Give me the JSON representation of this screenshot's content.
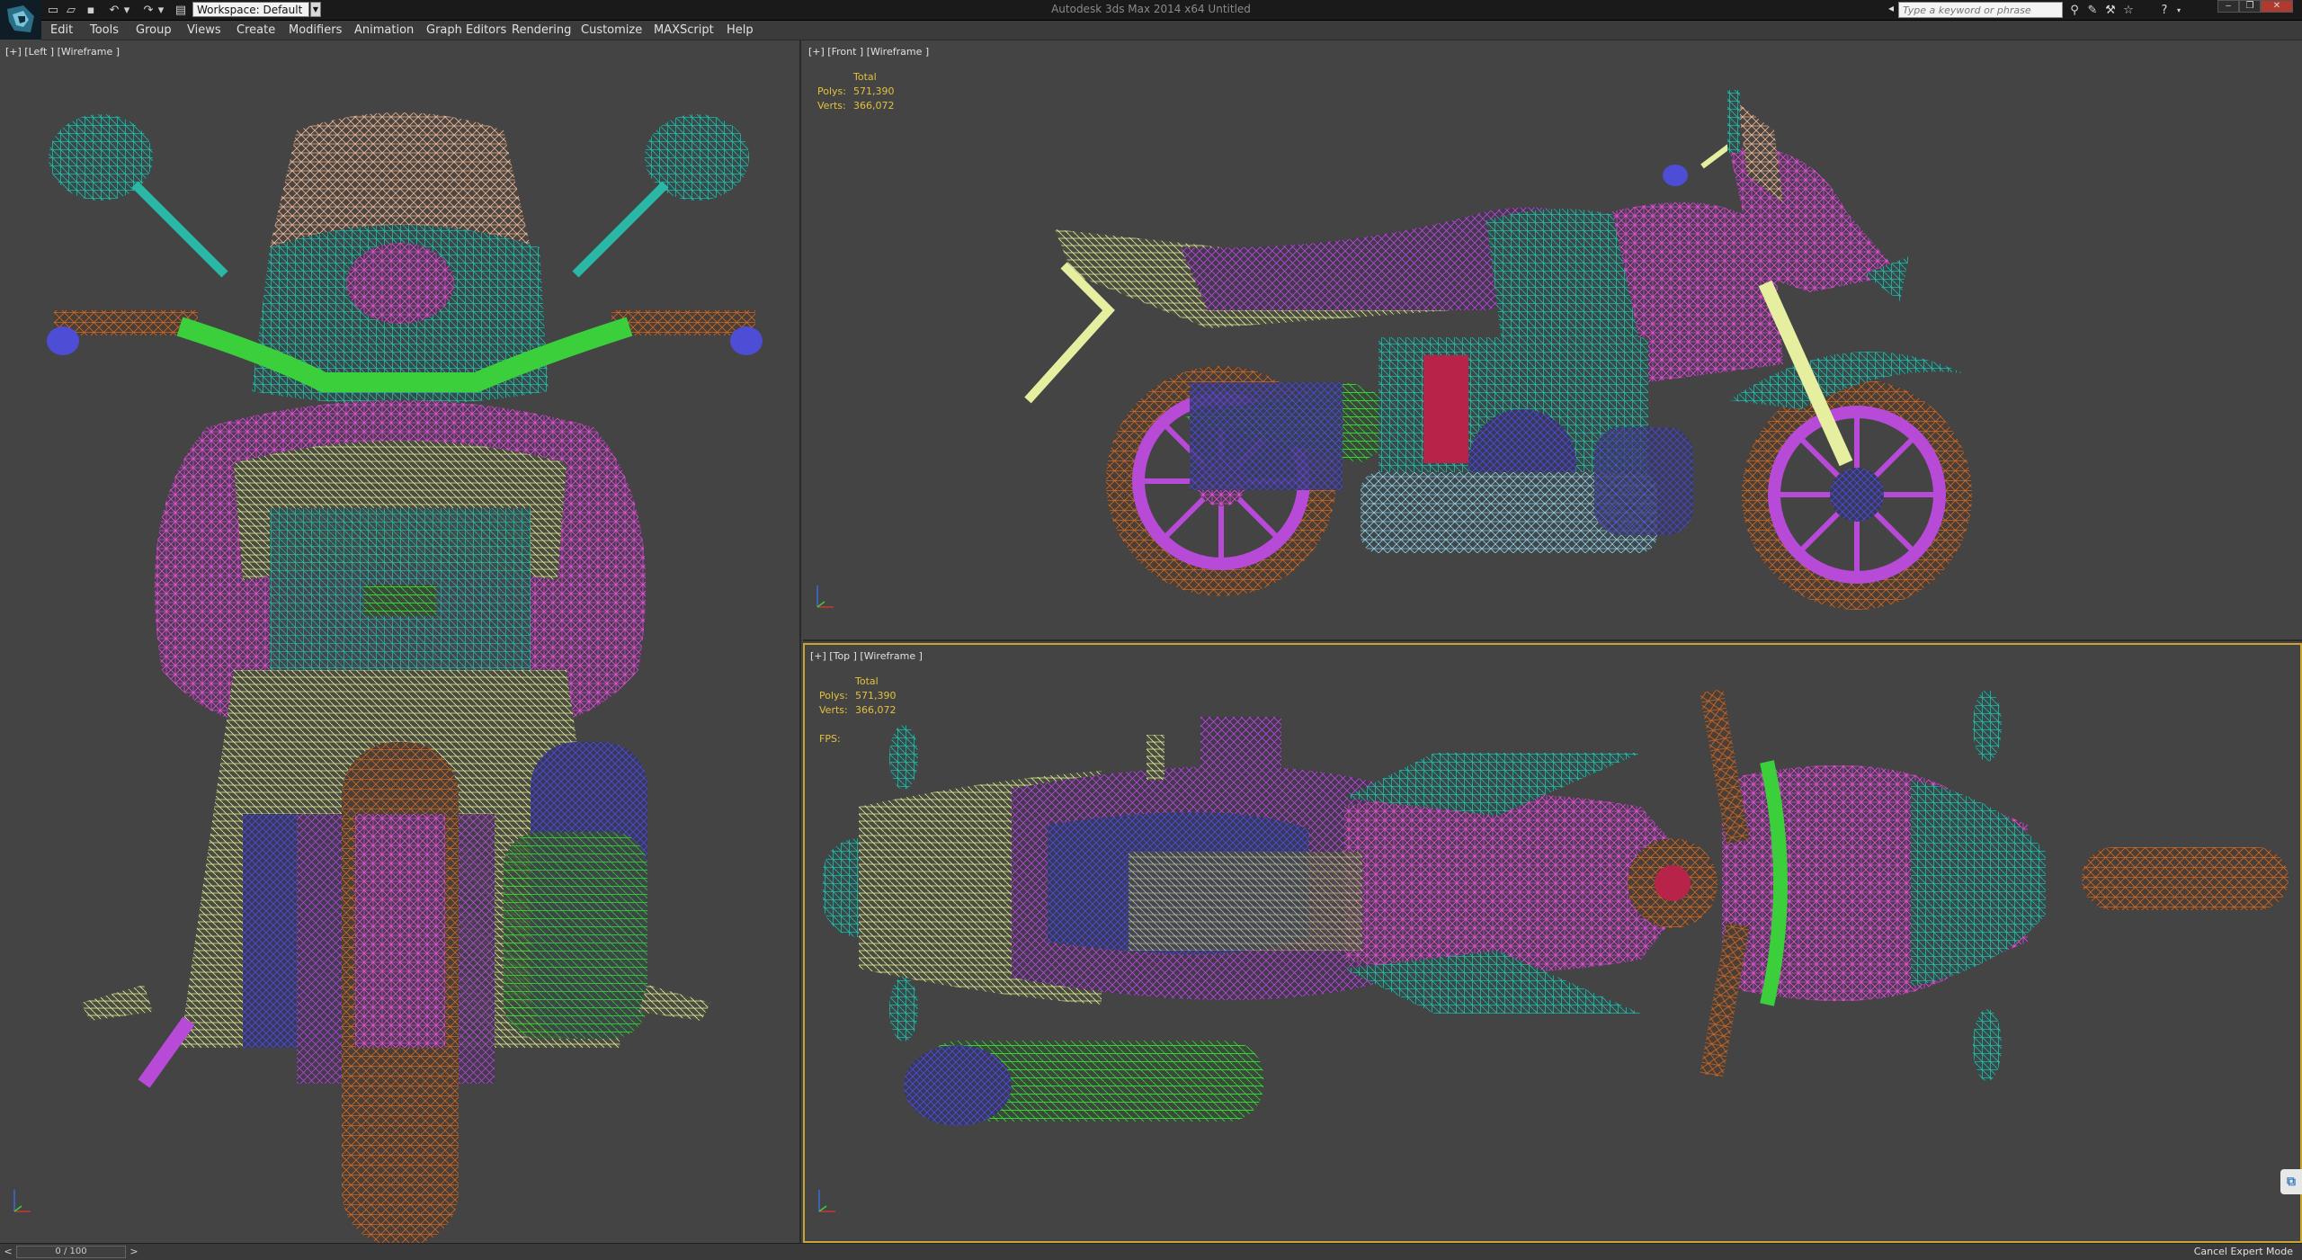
{
  "titlebar": {
    "workspace_label": "Workspace: Default",
    "window_title": "Autodesk 3ds Max  2014 x64     Untitled",
    "search_placeholder": "Type a keyword or phrase"
  },
  "menu": {
    "items": [
      "Edit",
      "Tools",
      "Group",
      "Views",
      "Create",
      "Modifiers",
      "Animation",
      "Graph Editors",
      "Rendering",
      "Customize",
      "MAXScript",
      "Help"
    ]
  },
  "viewports": {
    "left": {
      "label": "[+] [Left ] [Wireframe ]"
    },
    "front": {
      "label": "[+] [Front ] [Wireframe ]",
      "stats_title": "Total",
      "polys_label": "Polys:",
      "polys_value": "571,390",
      "verts_label": "Verts:",
      "verts_value": "366,072"
    },
    "top": {
      "label": "[+] [Top ] [Wireframe ]",
      "stats_title": "Total",
      "polys_label": "Polys:",
      "polys_value": "571,390",
      "verts_label": "Verts:",
      "verts_value": "366,072",
      "fps_label": "FPS:"
    }
  },
  "statusbar": {
    "time_value": "0 / 100",
    "expert_mode": "Cancel Expert Mode"
  },
  "colors": {
    "viewport_bg": "#444444",
    "active_border": "#c8a434",
    "stats_text": "#e3c13b",
    "wire_magenta": "#e050d0",
    "wire_teal": "#2ab7a5",
    "wire_orange": "#c86a2a",
    "wire_yellow": "#e6eea0",
    "wire_green": "#3ccf3c",
    "wire_blue": "#4d4dd6",
    "wire_violet": "#b84ad8",
    "wire_peach": "#e8b898"
  }
}
